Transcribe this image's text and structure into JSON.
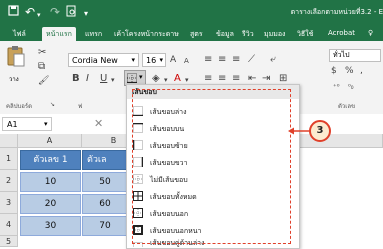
{
  "window": {
    "title": "ตารางเลือกตามหน่วยที่3.2 - E"
  },
  "quick_access": {
    "save": "save-icon",
    "undo": "undo-icon",
    "redo": "redo-icon",
    "preview": "print-preview-icon",
    "customize": "customize-icon"
  },
  "tabs": [
    {
      "label": "ไฟล์"
    },
    {
      "label": "หน้าแรก"
    },
    {
      "label": "แทรก"
    },
    {
      "label": "เค้าโครงหน้ากระดาษ"
    },
    {
      "label": "สูตร"
    },
    {
      "label": "ข้อมูล"
    },
    {
      "label": "รีวิว"
    },
    {
      "label": "มุมมอง"
    },
    {
      "label": "วิธีใช้"
    },
    {
      "label": "Acrobat"
    }
  ],
  "ribbon": {
    "paste_label": "วาง",
    "clipboard_group": "คลิปบอร์ด",
    "font_name": "Cordia New",
    "font_size": "16",
    "font_group": "ฟ",
    "number_format": "ทั่วไป",
    "number_group": "ตัวเลข",
    "bold": "B",
    "italic": "I",
    "underline": "U",
    "grow_font": "A",
    "shrink_font": "A",
    "percent": "%",
    "comma": ","
  },
  "formula_bar": {
    "name_box": "A1"
  },
  "columns": [
    "A",
    "B"
  ],
  "rows": [
    "1",
    "2",
    "3",
    "4",
    "5"
  ],
  "table": {
    "header_a": "ตัวเลข 1",
    "header_b": "ตัวเล",
    "values_a": [
      "10",
      "20",
      "30"
    ],
    "values_b": [
      "50",
      "60",
      "70"
    ]
  },
  "border_menu": {
    "title": "เส้นขอบ",
    "items": [
      {
        "label": "เส้นขอบล่าง",
        "icon": "border-bottom-icon"
      },
      {
        "label": "เส้นขอบบน",
        "icon": "border-top-icon"
      },
      {
        "label": "เส้นขอบซ้าย",
        "icon": "border-left-icon"
      },
      {
        "label": "เส้นขอบขวา",
        "icon": "border-right-icon"
      },
      {
        "label": "ไม่มีเส้นขอบ",
        "icon": "no-border-icon"
      },
      {
        "label": "เส้นขอบทั้งหมด",
        "icon": "all-borders-icon"
      },
      {
        "label": "เส้นขอบนอก",
        "icon": "outside-borders-icon"
      },
      {
        "label": "เส้นขอบนอกหนา",
        "icon": "thick-outside-border-icon"
      },
      {
        "label": "เส้นขอบคู่ด้านล่าง",
        "icon": "double-bottom-border-icon"
      }
    ]
  },
  "callout": {
    "number": "3"
  },
  "colors": {
    "excel_green": "#217346",
    "header_fill": "#4f81bd",
    "value_fill": "#b8cce4",
    "highlight": "#e0402a"
  }
}
